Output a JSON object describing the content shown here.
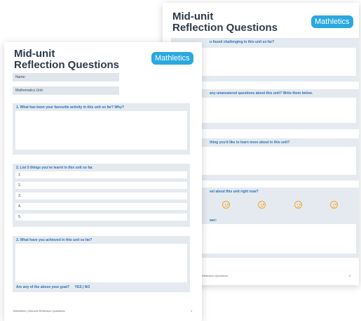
{
  "back_sheet": {
    "title_line1": "Mid-unit",
    "title_line2": "Reflection Questions",
    "logo": "Mathletics",
    "q1": "u found challenging in this unit so far?",
    "q2": "any unanswered questions about this unit? Write them below.",
    "q3": "thing you'd like to learn more about in this unit?",
    "q4": "eel about this unit right now?",
    "q5": "wer:",
    "footer_left": "Reflection Questions",
    "page_number": "2",
    "emoji_icons": [
      "very-sad-face-icon",
      "sad-face-icon",
      "happy-face-icon",
      "very-happy-face-icon"
    ]
  },
  "front_sheet": {
    "title_line1": "Mid-unit",
    "title_line2": "Reflection Questions",
    "logo": "Mathletics",
    "name_label": "Name:",
    "unit_label": "Mathematics Unit:",
    "q1": "1. What has been your favourite activity in this unit so far? Why?",
    "q2": "2. List 5 things you've learnt in this unit so far.",
    "list_items": [
      "1.",
      "2.",
      "3.",
      "4.",
      "5."
    ],
    "q3": "3. What have you achieved in this unit so far?",
    "goal_question": "Are any of the above your goal?",
    "goal_options": "YES | NO",
    "footer_left": "Mathletics | Mid-unit Reflection Questions",
    "page_number": "1"
  },
  "colors": {
    "accent_blue": "#2a6fb8",
    "logo_blue": "#2aa8e0",
    "panel_grey": "#e4eaef",
    "emoji_orange": "#f2a32b"
  }
}
